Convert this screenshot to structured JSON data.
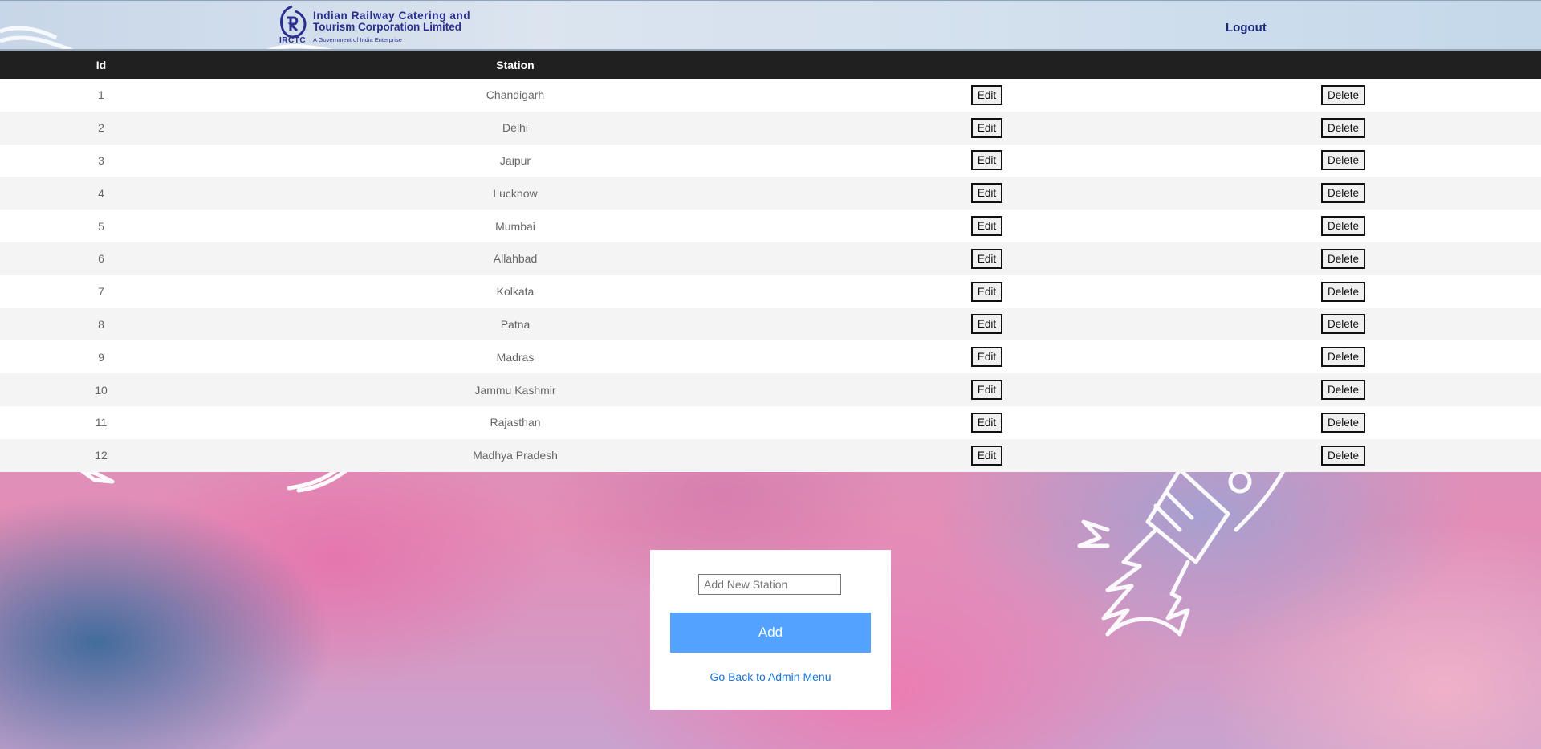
{
  "header": {
    "logo_caption": "IRCTC",
    "org_name_line1": "Indian Railway Catering and",
    "org_name_line2": "Tourism Corporation Limited",
    "org_tagline": "A Government of India Enterprise",
    "logout_label": "Logout"
  },
  "table": {
    "columns": [
      "Id",
      "Station",
      "",
      ""
    ],
    "edit_label": "Edit",
    "delete_label": "Delete",
    "rows": [
      {
        "id": "1",
        "station": "Chandigarh"
      },
      {
        "id": "2",
        "station": "Delhi"
      },
      {
        "id": "3",
        "station": "Jaipur"
      },
      {
        "id": "4",
        "station": "Lucknow"
      },
      {
        "id": "5",
        "station": "Mumbai"
      },
      {
        "id": "6",
        "station": "Allahbad"
      },
      {
        "id": "7",
        "station": "Kolkata"
      },
      {
        "id": "8",
        "station": "Patna"
      },
      {
        "id": "9",
        "station": "Madras"
      },
      {
        "id": "10",
        "station": "Jammu Kashmir"
      },
      {
        "id": "11",
        "station": "Rajasthan"
      },
      {
        "id": "12",
        "station": "Madhya Pradesh"
      }
    ]
  },
  "add_form": {
    "input_value": "",
    "input_placeholder": "Add New Station",
    "add_label": "Add",
    "back_link": "Go Back to Admin Menu"
  },
  "colors": {
    "header_text": "#2b2e8c",
    "table_header_bg": "#202020",
    "add_button": "#53a2ff",
    "link": "#1a73d6"
  }
}
